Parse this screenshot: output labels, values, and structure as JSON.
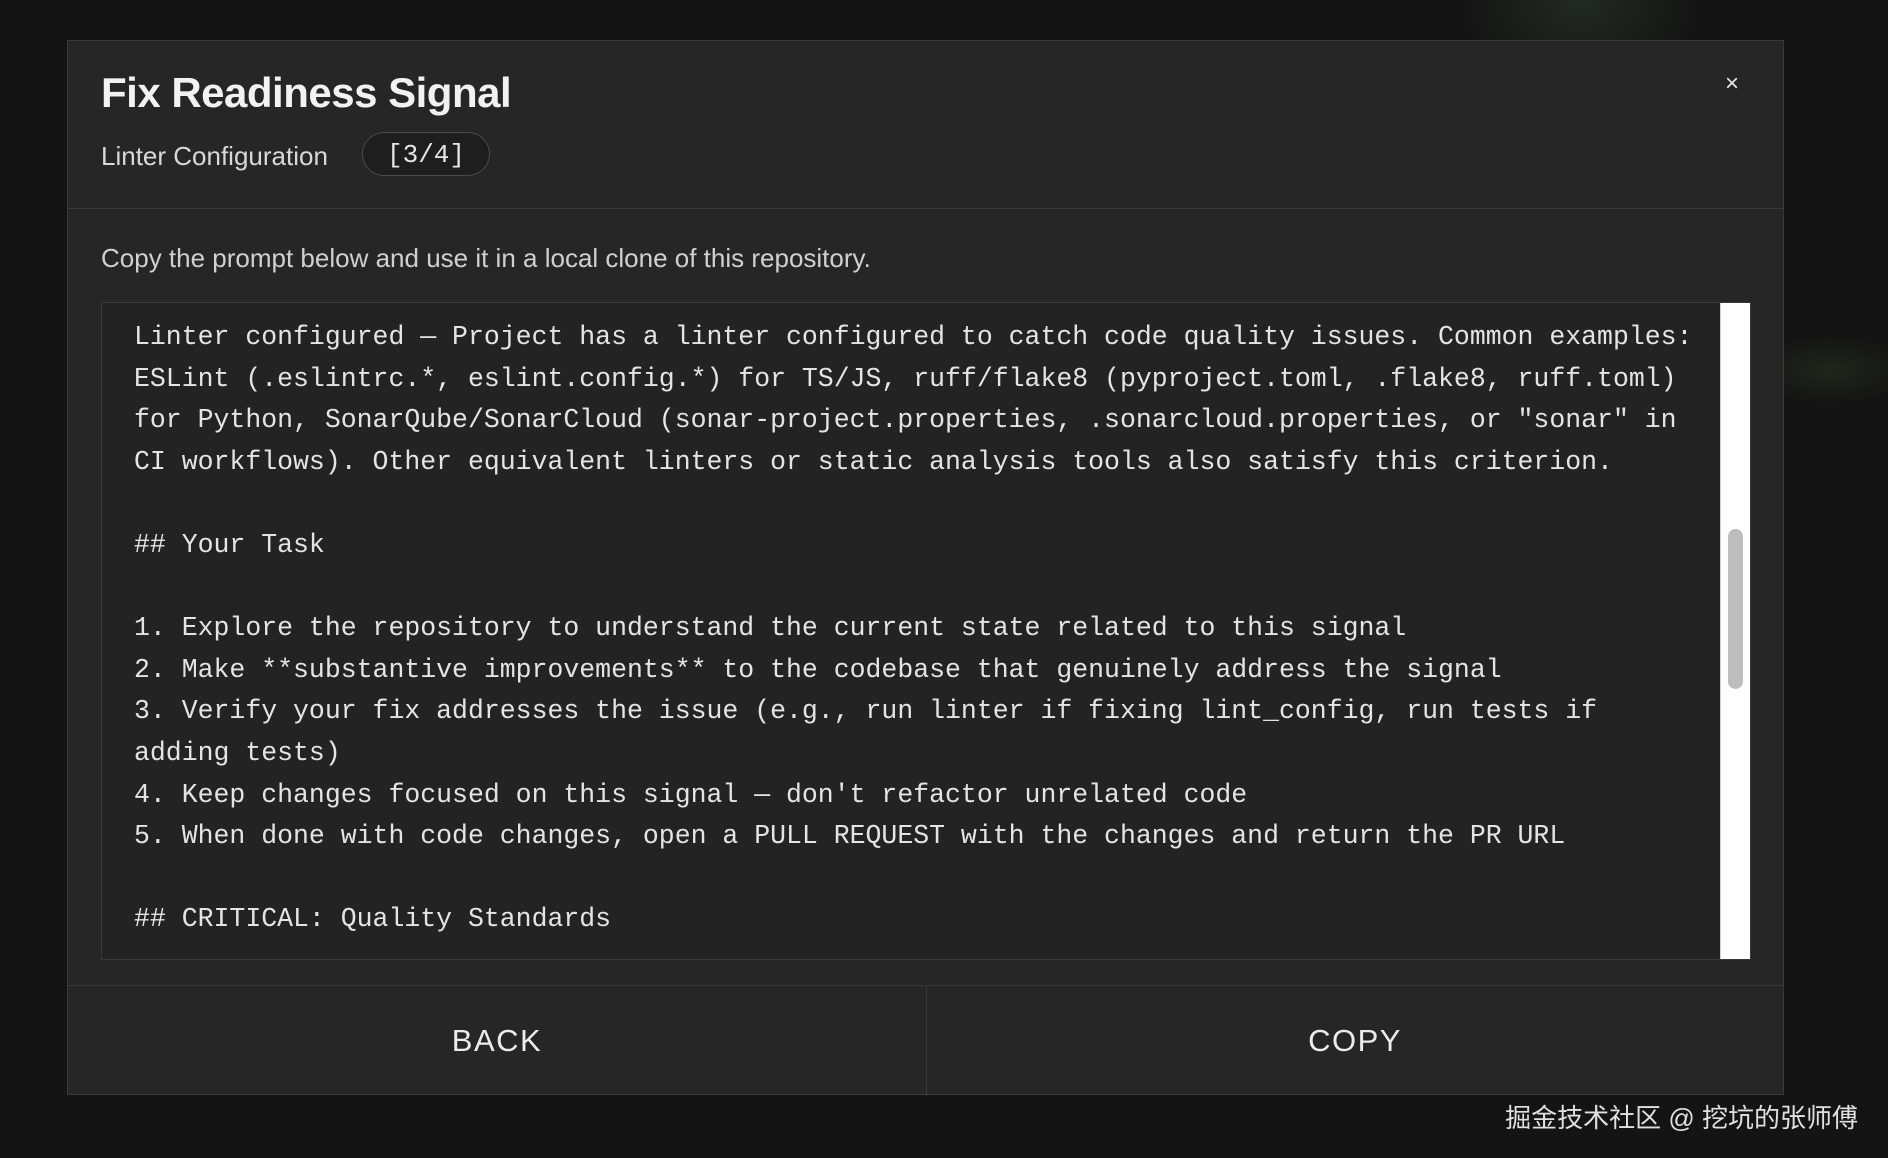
{
  "modal": {
    "title": "Fix Readiness Signal",
    "subtitle": "Linter Configuration",
    "step": "[3/4]",
    "close_icon": "×",
    "intro": "Copy the prompt below and use it in a local clone of this repository.",
    "prompt": "Linter configured — Project has a linter configured to catch code quality issues. Common examples: ESLint (.eslintrc.*, eslint.config.*) for TS/JS, ruff/flake8 (pyproject.toml, .flake8, ruff.toml) for Python, SonarQube/SonarCloud (sonar-project.properties, .sonarcloud.properties, or \"sonar\" in CI workflows). Other equivalent linters or static analysis tools also satisfy this criterion.\n\n## Your Task\n\n1. Explore the repository to understand the current state related to this signal\n2. Make **substantive improvements** to the codebase that genuinely address the signal\n3. Verify your fix addresses the issue (e.g., run linter if fixing lint_config, run tests if adding tests)\n4. Keep changes focused on this signal — don't refactor unrelated code\n5. When done with code changes, open a PULL REQUEST with the changes and return the PR URL\n\n## CRITICAL: Quality Standards\n",
    "back_label": "BACK",
    "copy_label": "COPY"
  },
  "watermark": "掘金技术社区 @ 挖坑的张师傅"
}
